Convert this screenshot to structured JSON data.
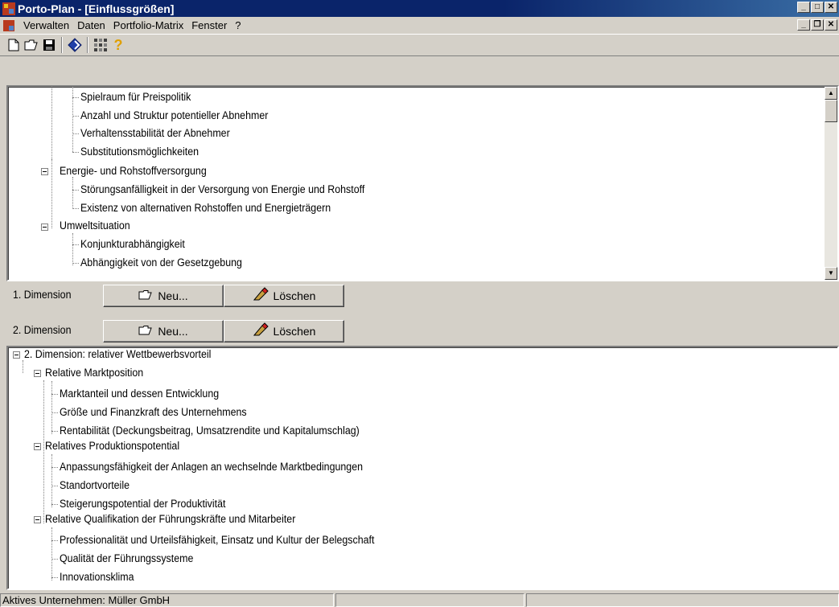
{
  "window": {
    "title": "Porto-Plan - [Einflussgrößen]"
  },
  "menu": [
    "Verwalten",
    "Daten",
    "Portfolio-Matrix",
    "Fenster",
    "?"
  ],
  "toolbar": {
    "icons": [
      "new-file-icon",
      "open-folder-icon",
      "save-disk-icon",
      "diamond-icon",
      "scan-grid-icon",
      "help-icon"
    ]
  },
  "tree_top": {
    "nodes": [
      {
        "label": "Spielraum für Preispolitik",
        "level": 3
      },
      {
        "label": "Anzahl und Struktur potentieller Abnehmer",
        "level": 3
      },
      {
        "label": "Verhaltensstabilität der Abnehmer",
        "level": 3
      },
      {
        "label": "Substitutionsmöglichkeiten",
        "level": 3
      },
      {
        "label": "Energie- und Rohstoffversorgung",
        "level": 2
      },
      {
        "label": "Störungsanfälligkeit in der Versorgung von Energie und Rohstoff",
        "level": 3
      },
      {
        "label": "Existenz von alternativen Rohstoffen und Energieträgern",
        "level": 3
      },
      {
        "label": "Umweltsituation",
        "level": 2
      },
      {
        "label": "Konjunkturabhängigkeit",
        "level": 3
      },
      {
        "label": "Abhängigkeit von der Gesetzgebung",
        "level": 3
      }
    ]
  },
  "dim1": {
    "label": "1. Dimension",
    "new_label": "Neu...",
    "delete_label": "Löschen"
  },
  "dim2": {
    "label": "2. Dimension",
    "new_label": "Neu...",
    "delete_label": "Löschen"
  },
  "tree_bottom": {
    "nodes": [
      {
        "label": "2. Dimension: relativer Wettbewerbsvorteil",
        "level": 1
      },
      {
        "label": "Relative Marktposition",
        "level": 2
      },
      {
        "label": "Marktanteil und dessen Entwicklung",
        "level": 3
      },
      {
        "label": "Größe und Finanzkraft des Unternehmens",
        "level": 3
      },
      {
        "label": "Rentabilität (Deckungsbeitrag, Umsatzrendite und Kapitalumschlag)",
        "level": 3
      },
      {
        "label": "Relatives Produktionspotential",
        "level": 2
      },
      {
        "label": "Anpassungsfähigkeit der Anlagen an wechselnde Marktbedingungen",
        "level": 3
      },
      {
        "label": "Standortvorteile",
        "level": 3
      },
      {
        "label": "Steigerungspotential der Produktivität",
        "level": 3
      },
      {
        "label": "Relative Qualifikation der Führungskräfte und Mitarbeiter",
        "level": 2
      },
      {
        "label": "Professionalität und Urteilsfähigkeit, Einsatz und Kultur der Belegschaft",
        "level": 3
      },
      {
        "label": "Qualität der Führungssysteme",
        "level": 3
      },
      {
        "label": "Innovationsklima",
        "level": 3
      }
    ]
  },
  "status": {
    "active_company": "Aktives Unternehmen: Müller GmbH"
  }
}
